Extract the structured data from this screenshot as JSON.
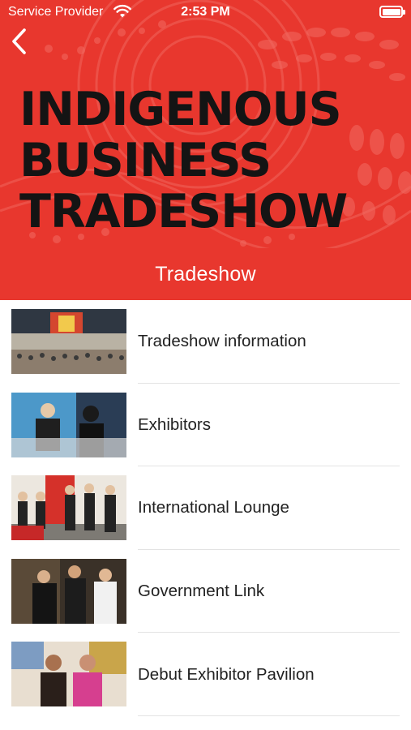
{
  "status_bar": {
    "carrier": "Service Provider",
    "time": "2:53 PM",
    "icons": [
      "wifi-icon",
      "battery-icon"
    ]
  },
  "nav": {
    "back_icon": "chevron-left-icon",
    "title": "Tradeshow"
  },
  "banner": {
    "lines": [
      "INDIGENOUS",
      "BUSINESS",
      "TRADESHOW"
    ],
    "background_color": "#e8372e",
    "text_color": "#141414"
  },
  "menu": {
    "items": [
      {
        "label": "Tradeshow information"
      },
      {
        "label": "Exhibitors"
      },
      {
        "label": "International Lounge"
      },
      {
        "label": "Government Link"
      },
      {
        "label": "Debut Exhibitor Pavilion"
      }
    ]
  }
}
